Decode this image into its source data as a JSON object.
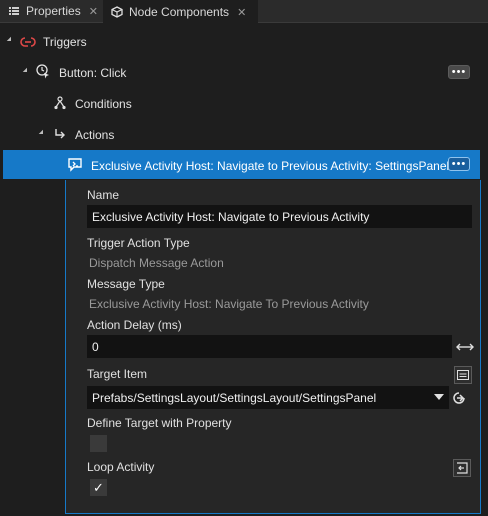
{
  "tabs": [
    {
      "label": "Properties",
      "icon": "list-icon",
      "close": "✕"
    },
    {
      "label": "Node Components",
      "icon": "components-icon",
      "close": "✕"
    }
  ],
  "tree": {
    "triggers": "Triggers",
    "button_click": "Button: Click",
    "conditions": "Conditions",
    "actions": "Actions",
    "selected_action": "Exclusive Activity Host: Navigate to Previous Activity: SettingsPanel",
    "more_label": "•••"
  },
  "properties": {
    "name_label": "Name",
    "name_value": "Exclusive Activity Host: Navigate to Previous Activity",
    "trigger_action_type_label": "Trigger Action Type",
    "trigger_action_type_value": "Dispatch Message Action",
    "message_type_label": "Message Type",
    "message_type_value": "Exclusive Activity Host: Navigate To Previous Activity",
    "action_delay_label": "Action Delay (ms)",
    "action_delay_value": "0",
    "target_item_label": "Target Item",
    "target_item_value": "Prefabs/SettingsLayout/SettingsLayout/SettingsPanel",
    "define_target_label": "Define Target with Property",
    "define_target_checked": false,
    "loop_activity_label": "Loop Activity",
    "loop_activity_checked": true,
    "check_glyph": "✓"
  },
  "colors": {
    "accent": "#1679c8",
    "trigger_icon": "#e04848"
  }
}
